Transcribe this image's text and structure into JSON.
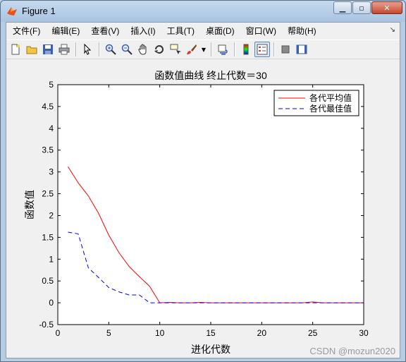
{
  "window": {
    "title": "Figure 1"
  },
  "menu": [
    {
      "label": "文件(F)"
    },
    {
      "label": "编辑(E)"
    },
    {
      "label": "查看(V)"
    },
    {
      "label": "插入(I)"
    },
    {
      "label": "工具(T)"
    },
    {
      "label": "桌面(D)"
    },
    {
      "label": "窗口(W)"
    },
    {
      "label": "帮助(H)"
    }
  ],
  "toolbar": {
    "icons": [
      "new-figure-icon",
      "open-file-icon",
      "save-icon",
      "print-icon",
      "edit-plot-icon",
      "zoom-in-icon",
      "zoom-out-icon",
      "pan-icon",
      "rotate-3d-icon",
      "data-cursor-icon",
      "brush-icon",
      "link-plot-icon",
      "colorbar-icon",
      "legend-icon",
      "hide-plot-tools-icon",
      "show-plot-tools-icon"
    ]
  },
  "chart_data": {
    "type": "line",
    "title": "函数值曲线 终止代数＝30",
    "xlabel": "进化代数",
    "ylabel": "函数值",
    "xlim": [
      0,
      30
    ],
    "ylim": [
      -0.5,
      5
    ],
    "xticks": [
      "0",
      "5",
      "10",
      "15",
      "20",
      "25",
      "30"
    ],
    "yticks": [
      "-0.5",
      "0",
      "0.5",
      "1",
      "1.5",
      "2",
      "2.5",
      "3",
      "3.5",
      "4",
      "4.5",
      "5"
    ],
    "grid": false,
    "legend_position": "top-right",
    "x": [
      1,
      2,
      3,
      4,
      5,
      6,
      7,
      8,
      9,
      10,
      11,
      12,
      13,
      14,
      15,
      16,
      17,
      18,
      19,
      20,
      21,
      22,
      23,
      24,
      25,
      26,
      27,
      28,
      29,
      30
    ],
    "series": [
      {
        "name": "各代平均值",
        "color": "#ff0000",
        "style": "solid",
        "values": [
          3.12,
          2.75,
          2.45,
          2.05,
          1.55,
          1.15,
          0.83,
          0.6,
          0.38,
          0.0,
          0.01,
          0.0,
          0.0,
          0.01,
          0.0,
          0.0,
          0.0,
          0.0,
          0.0,
          0.0,
          0.0,
          0.0,
          0.0,
          0.0,
          0.02,
          0.0,
          0.0,
          0.0,
          0.0,
          0.0
        ]
      },
      {
        "name": "各代最佳值",
        "color": "#0000ff",
        "style": "dashed",
        "values": [
          1.62,
          1.58,
          0.8,
          0.58,
          0.35,
          0.25,
          0.18,
          0.18,
          0.0,
          0.0,
          0.0,
          0.0,
          0.0,
          0.0,
          0.0,
          0.0,
          0.0,
          0.0,
          0.0,
          0.0,
          0.0,
          0.0,
          0.0,
          0.0,
          0.0,
          0.0,
          0.0,
          0.0,
          0.0,
          0.0
        ]
      }
    ]
  },
  "watermark": "CSDN @mozun2020"
}
